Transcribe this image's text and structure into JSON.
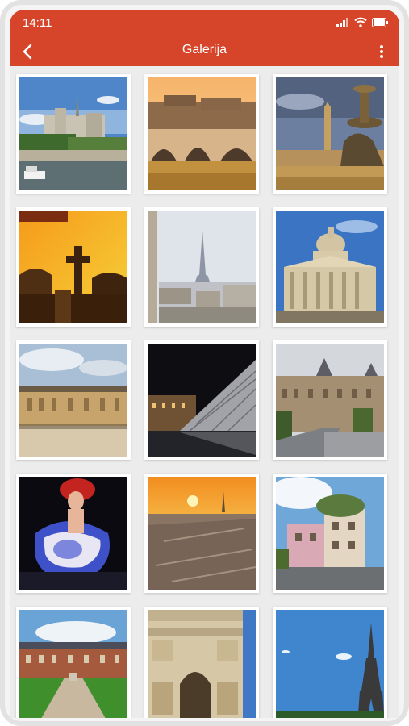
{
  "status_bar": {
    "time": "14:11"
  },
  "app_bar": {
    "title": "Galerija",
    "back_icon": "back-arrow-icon",
    "menu_icon": "more-vertical-icon",
    "color": "#d6442a"
  },
  "gallery": {
    "photos": [
      {
        "subject": "notre-dame-seine"
      },
      {
        "subject": "pont-neuf-sunset"
      },
      {
        "subject": "concorde-fountain"
      },
      {
        "subject": "cemetery-cross-sunset"
      },
      {
        "subject": "eiffel-rooftops-haze"
      },
      {
        "subject": "pantheon"
      },
      {
        "subject": "versailles-palace"
      },
      {
        "subject": "louvre-pyramid-night"
      },
      {
        "subject": "louvre-courtyard"
      },
      {
        "subject": "cancan-dancer"
      },
      {
        "subject": "paris-skyline-sunset"
      },
      {
        "subject": "montmartre-pink-house"
      },
      {
        "subject": "place-des-vosges"
      },
      {
        "subject": "arc-de-triomphe"
      },
      {
        "subject": "eiffel-tower-blue-sky"
      }
    ]
  }
}
